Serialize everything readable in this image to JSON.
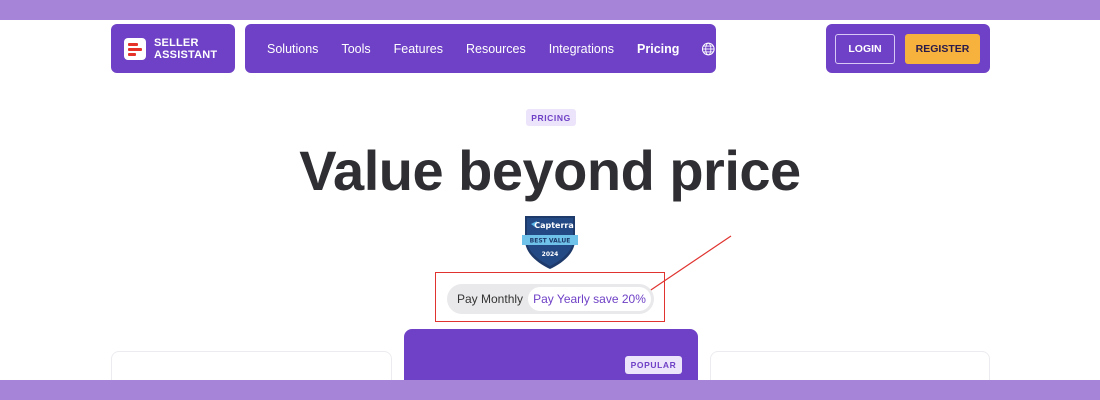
{
  "brand": {
    "line1": "SELLER",
    "line2": "ASSISTANT"
  },
  "nav": {
    "items": [
      {
        "label": "Solutions",
        "active": false
      },
      {
        "label": "Tools",
        "active": false
      },
      {
        "label": "Features",
        "active": false
      },
      {
        "label": "Resources",
        "active": false
      },
      {
        "label": "Integrations",
        "active": false
      },
      {
        "label": "Pricing",
        "active": true
      }
    ],
    "language_icon": "globe-icon"
  },
  "auth": {
    "login_label": "LOGIN",
    "register_label": "REGISTER"
  },
  "hero": {
    "eyebrow": "PRICING",
    "title": "Value beyond price"
  },
  "badge": {
    "brand": "Capterra",
    "ribbon": "BEST VALUE",
    "year": "2024"
  },
  "billing_toggle": {
    "monthly_label": "Pay Monthly",
    "yearly_label": "Pay Yearly save 20%",
    "selected": "yearly"
  },
  "plans": {
    "popular_label": "POPULAR"
  },
  "colors": {
    "brand_purple": "#6f41c6",
    "accent_orange": "#f6b23c",
    "annotation_red": "#e0332f",
    "outer_background": "#a685d8"
  }
}
